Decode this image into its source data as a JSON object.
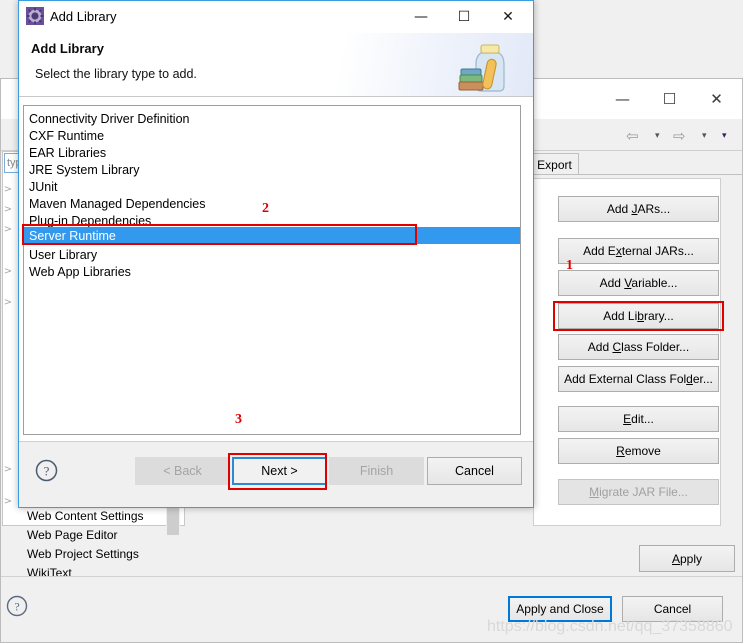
{
  "background_window": {
    "title_controls": {
      "minimize": "—",
      "maximize": "☐",
      "close": "✕"
    },
    "toolbar": {
      "back_arrow": "⇦",
      "back_caret": "▾",
      "forward_arrow": "⇨",
      "forward_caret": "▾",
      "menu_caret": "▾"
    },
    "filter_text": "type",
    "tree_items": [
      {
        "label": "",
        "chevron": ">"
      },
      {
        "label": "",
        "chevron": ">"
      },
      {
        "label": "",
        "chevron": ">"
      },
      {
        "label": "",
        "chevron": ">"
      },
      {
        "label": "",
        "chevron": ">"
      },
      {
        "label": "",
        "chevron": ">"
      },
      {
        "label": "",
        "chevron": ">"
      },
      {
        "label": "",
        "chevron": ">"
      }
    ],
    "tree_visible_labels": [
      "Web Content Settings",
      "Web Page Editor",
      "Web Project Settings",
      "WikiText"
    ],
    "tab_label": "Export",
    "classpath_buttons": [
      {
        "label": "Add JARs...",
        "mnemonic": "J",
        "disabled": false
      },
      {
        "label": "Add External JARs...",
        "mnemonic": "x",
        "disabled": false
      },
      {
        "label": "Add Variable...",
        "mnemonic": "V",
        "disabled": false
      },
      {
        "label": "Add Library...",
        "mnemonic": "b",
        "disabled": false
      },
      {
        "label": "Add Class Folder...",
        "mnemonic": "C",
        "disabled": false
      },
      {
        "label": "Add External Class Folder...",
        "mnemonic": "d",
        "disabled": false
      },
      {
        "label": "Edit...",
        "mnemonic": "E",
        "disabled": false
      },
      {
        "label": "Remove",
        "mnemonic": "R",
        "disabled": false
      },
      {
        "label": "Migrate JAR File...",
        "mnemonic": "M",
        "disabled": true
      }
    ],
    "apply_label": "Apply",
    "apply_and_close_label": "Apply and Close",
    "cancel_label": "Cancel",
    "help_icon": "?",
    "scroll_down_icon": "⌄",
    "watermark": "https://blog.csdn.net/qq_37358860"
  },
  "dialog": {
    "window_title": "Add Library",
    "icon": "gear-icon",
    "title_controls": {
      "minimize": "—",
      "maximize": "☐",
      "close": "✕"
    },
    "header_title": "Add Library",
    "header_subtitle": "Select the library type to add.",
    "header_image": "library-jar-books-icon",
    "list_items": [
      {
        "label": "Connectivity Driver Definition",
        "selected": false
      },
      {
        "label": "CXF Runtime",
        "selected": false
      },
      {
        "label": "EAR Libraries",
        "selected": false
      },
      {
        "label": "JRE System Library",
        "selected": false
      },
      {
        "label": "JUnit",
        "selected": false
      },
      {
        "label": "Maven Managed Dependencies",
        "selected": false
      },
      {
        "label": "Plug-in Dependencies",
        "selected": false
      },
      {
        "label": "Server Runtime",
        "selected": true
      },
      {
        "label": "User Library",
        "selected": false
      },
      {
        "label": "Web App Libraries",
        "selected": false
      }
    ],
    "help_icon": "?",
    "buttons": {
      "back": "< Back",
      "next": "Next >",
      "finish": "Finish",
      "cancel": "Cancel"
    }
  },
  "annotations": {
    "one": "1",
    "two": "2",
    "three": "3",
    "color": "#e00000"
  }
}
